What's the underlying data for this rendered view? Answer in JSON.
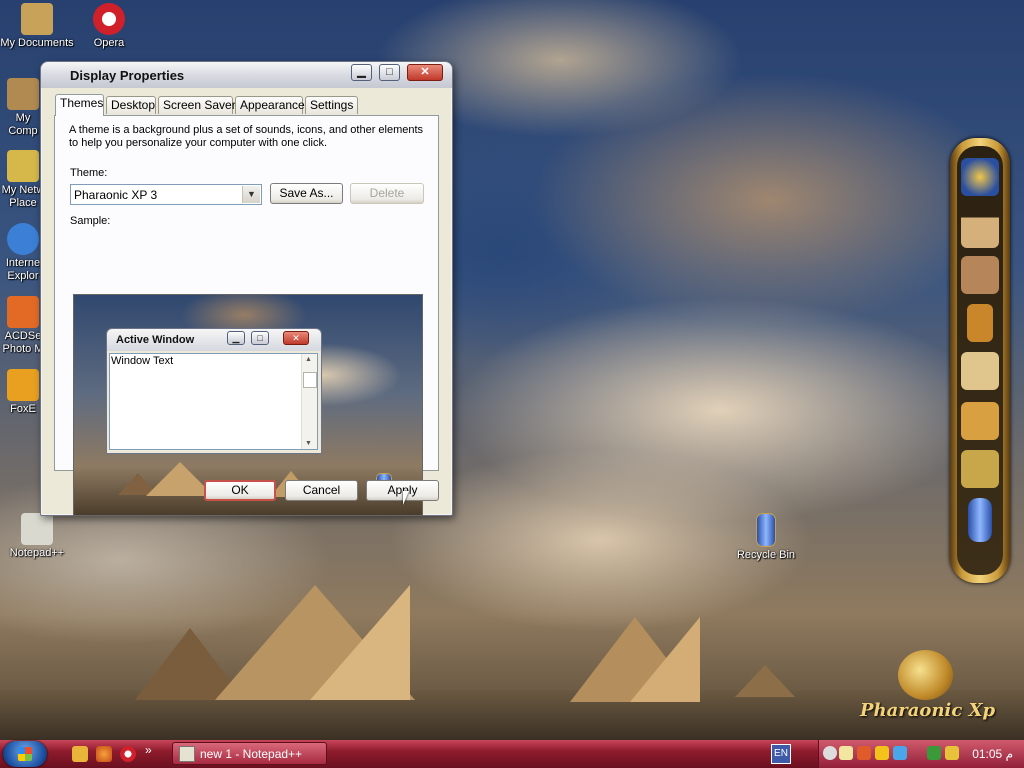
{
  "desktop": {
    "icons": [
      {
        "label": "My Documents",
        "icon": "pharaoh-statue-icon",
        "color": "#c9a25a"
      },
      {
        "label": "Opera",
        "icon": "opera-icon",
        "color": "#d0202a"
      },
      {
        "label": "My Comp",
        "icon": "computer-icon",
        "color": "#b08a50"
      },
      {
        "label": "My Netw Place",
        "icon": "network-icon",
        "color": "#d6b84a"
      },
      {
        "label": "Interne Explor",
        "icon": "ie-icon",
        "color": "#3b7fd6"
      },
      {
        "label": "ACDSe Photo M",
        "icon": "acdsee-icon",
        "color": "#e36a24"
      },
      {
        "label": "FoxE",
        "icon": "foxit-icon",
        "color": "#e9a020"
      },
      {
        "label": "Notepad++",
        "icon": "notepad-icon",
        "color": "#d9d9cf"
      },
      {
        "label": "Recycle Bin",
        "icon": "recycle-bin-icon",
        "color": "#3a62c9"
      }
    ],
    "logo_text": "Pharaonic Xp"
  },
  "dock": {
    "items": [
      "pharaoh-mask-icon",
      "pyramids-icon",
      "scribe-statue-icon",
      "harp-icon",
      "book-icon",
      "tools-icon",
      "register-icon",
      "cartouche-icon"
    ]
  },
  "dialog": {
    "title": "Display Properties",
    "title_buttons": {
      "minimize": "▁",
      "maximize": "□",
      "close": "✕"
    },
    "tabs": [
      "Themes",
      "Desktop",
      "Screen Saver",
      "Appearance",
      "Settings"
    ],
    "description": "A theme is a background plus a set of sounds, icons, and other elements to help you personalize your computer with one click.",
    "theme_label": "Theme:",
    "theme_value": "Pharaonic XP 3",
    "save_as": "Save As...",
    "delete": "Delete",
    "sample_label": "Sample:",
    "sample": {
      "window_title": "Active Window",
      "window_text": "Window Text"
    },
    "ok": "OK",
    "cancel": "Cancel",
    "apply": "Apply"
  },
  "taskbar": {
    "quick_launch": [
      "winamp-icon",
      "firefox-icon",
      "opera-icon"
    ],
    "overflow": "»",
    "tasks": [
      {
        "label": "new 1 - Notepad++"
      }
    ],
    "language": "EN",
    "clock": "01:05 م"
  }
}
